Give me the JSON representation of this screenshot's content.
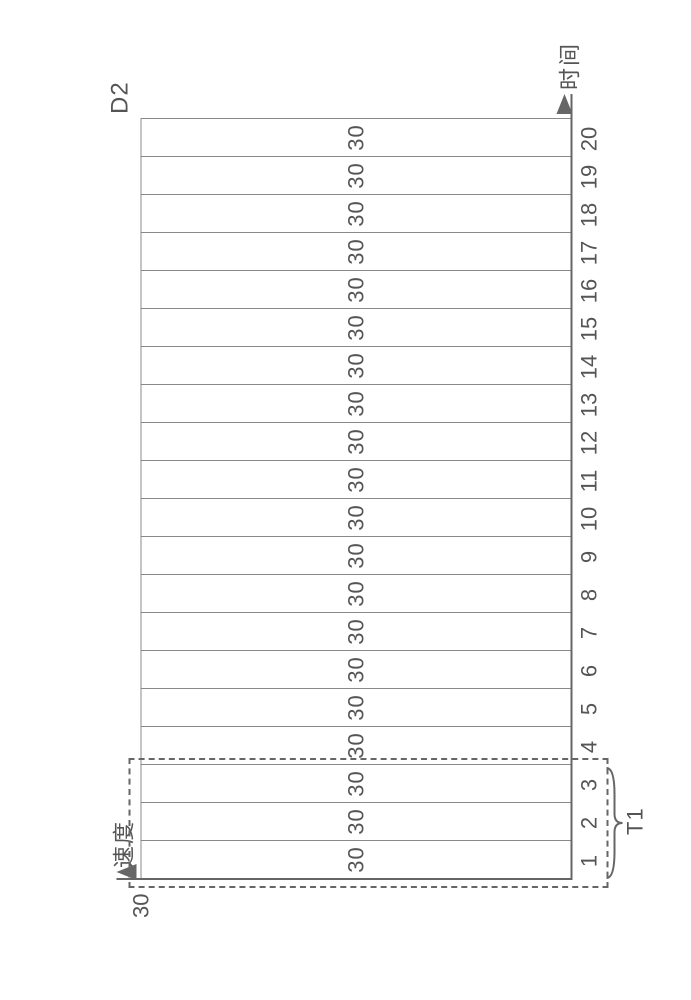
{
  "chart_data": {
    "type": "bar",
    "categories": [
      "1",
      "2",
      "3",
      "4",
      "5",
      "6",
      "7",
      "8",
      "9",
      "10",
      "11",
      "12",
      "13",
      "14",
      "15",
      "16",
      "17",
      "18",
      "19",
      "20"
    ],
    "values": [
      30,
      30,
      30,
      30,
      30,
      30,
      30,
      30,
      30,
      30,
      30,
      30,
      30,
      30,
      30,
      30,
      30,
      30,
      30,
      30
    ],
    "title": "",
    "xlabel": "时间",
    "ylabel": "速度",
    "ylim": [
      0,
      30
    ],
    "y_ticks": [
      30
    ],
    "series_label": "D2",
    "highlight": {
      "label": "T1",
      "start_index": 0,
      "end_index": 2
    }
  }
}
